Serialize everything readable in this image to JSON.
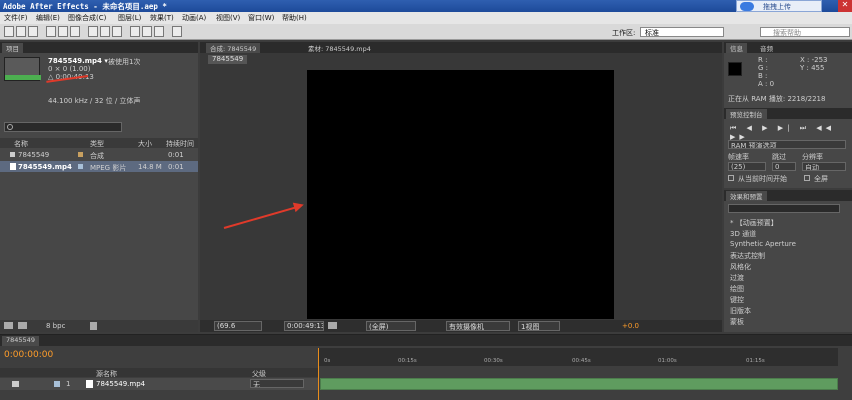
{
  "window": {
    "title": "Adobe After Effects - 未命名项目.aep *",
    "upload": "拖拽上传",
    "close": "✕"
  },
  "menu": [
    "文件(F)",
    "编辑(E)",
    "图像合成(C)",
    "图层(L)",
    "效果(T)",
    "动画(A)",
    "视图(V)",
    "窗口(W)",
    "帮助(H)"
  ],
  "toolbar": {
    "workspace_label": "工作区:",
    "workspace_value": "标准",
    "search_placeholder": "搜索帮助"
  },
  "project": {
    "tab": "项目",
    "item_name": "7845549.mp4 ▾",
    "item_used": "被使用1次",
    "item_size": "0 × 0 (1.00)",
    "item_duration": "△ 0:00:49:13",
    "item_audio": "44.100 kHz / 32 位 / 立体声",
    "columns": {
      "name": "名称",
      "type": "类型",
      "size": "大小",
      "duration": "持续时间"
    },
    "rows": [
      {
        "name": "7845549",
        "type": "合成",
        "size": "",
        "duration": "0:01"
      },
      {
        "name": "7845549.mp4",
        "type": "MPEG 影片",
        "size": "14.8 M",
        "duration": "0:01"
      }
    ],
    "bpc": "8 bpc"
  },
  "viewer": {
    "tab_comp": "合成: 7845549",
    "tab_footage": "素材: 7845549.mp4",
    "crumb": "7845549",
    "zoom": "(69.6",
    "timecode": "0:00:49:13",
    "quality": "(全屏)",
    "camera": "有效摄像机",
    "views": "1视图",
    "offset": "+0.0"
  },
  "info": {
    "tab1": "信息",
    "tab2": "音频",
    "r": "R :",
    "g": "G :",
    "b": "B :",
    "a": "A : 0",
    "x": "X : -253",
    "y": "Y : 455",
    "ram": "正在从 RAM 播放: 2218/2218"
  },
  "preview": {
    "tab": "预览控制台",
    "ram_options": "RAM 预演选项",
    "frame_rate_label": "帧速率",
    "skip_label": "跳过",
    "resolution_label": "分辨率",
    "frame_rate": "(25)",
    "skip": "0",
    "resolution": "自动",
    "from_current": "从当前时间开始",
    "fullscreen": "全屏"
  },
  "effects": {
    "tab": "效果和预置",
    "items": [
      "* 【动画预置】",
      "3D 通道",
      "Synthetic Aperture",
      "表达式控制",
      "风格化",
      "过渡",
      "绘图",
      "键控",
      "旧版本",
      "蒙板"
    ]
  },
  "timeline": {
    "tab": "7845549",
    "timecode": "0:00:00:00",
    "ruler": [
      "0s",
      "00:15s",
      "00:30s",
      "00:45s",
      "01:00s",
      "01:15s"
    ],
    "col_name": "源名称",
    "col_parent": "父级",
    "layer_num": "1",
    "layer_name": "7845549.mp4",
    "parent_value": "无"
  },
  "colors": {
    "title_blue": "#2f5fb0",
    "arrow_red": "#e03a2a",
    "timecode_orange": "#ff9d2a",
    "layer_green": "#5f9c5f"
  }
}
